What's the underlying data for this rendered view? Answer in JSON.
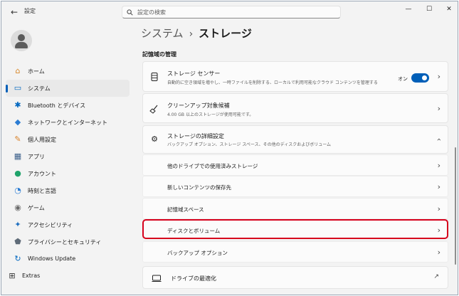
{
  "app": {
    "title": "設定",
    "back_icon": "arrow-left-icon"
  },
  "search": {
    "placeholder": "設定の検索"
  },
  "window_controls": {
    "minimize": "—",
    "maximize": "☐",
    "close": "✕"
  },
  "sidebar": {
    "items": [
      {
        "label": "ホーム",
        "icon": "home-icon",
        "glyph": "⌂",
        "color": "#d9882a",
        "active": false
      },
      {
        "label": "システム",
        "icon": "system-icon",
        "glyph": "▭",
        "color": "#0067c0",
        "active": true
      },
      {
        "label": "Bluetooth とデバイス",
        "icon": "bluetooth-icon",
        "glyph": "✱",
        "color": "#0067c0",
        "active": false
      },
      {
        "label": "ネットワークとインターネット",
        "icon": "network-icon",
        "glyph": "◆",
        "color": "#2b7cd3",
        "active": false
      },
      {
        "label": "個人用設定",
        "icon": "brush-icon",
        "glyph": "✎",
        "color": "#d9822b",
        "active": false
      },
      {
        "label": "アプリ",
        "icon": "apps-icon",
        "glyph": "▦",
        "color": "#3b5f8a",
        "active": false
      },
      {
        "label": "アカウント",
        "icon": "account-icon",
        "glyph": "●",
        "color": "#1fa36a",
        "active": false
      },
      {
        "label": "時刻と言語",
        "icon": "time-language-icon",
        "glyph": "◔",
        "color": "#2b7cd3",
        "active": false
      },
      {
        "label": "ゲーム",
        "icon": "gaming-icon",
        "glyph": "◉",
        "color": "#6b6b6b",
        "active": false
      },
      {
        "label": "アクセシビリティ",
        "icon": "accessibility-icon",
        "glyph": "✦",
        "color": "#1f6fc0",
        "active": false
      },
      {
        "label": "プライバシーとセキュリティ",
        "icon": "shield-icon",
        "glyph": "⬟",
        "color": "#5f6b78",
        "active": false
      },
      {
        "label": "Windows Update",
        "icon": "windows-update-icon",
        "glyph": "↻",
        "color": "#0067c0",
        "active": false
      },
      {
        "label": "Extras",
        "icon": "extras-icon",
        "glyph": "⊞",
        "color": "#333333",
        "active": false
      }
    ]
  },
  "breadcrumb": {
    "parent": "システム",
    "separator": "›",
    "current": "ストレージ"
  },
  "section": {
    "title": "記憶域の管理"
  },
  "storage_sense": {
    "title": "ストレージ センサー",
    "description": "自動的に空き領域を増やし、一時ファイルを削除する、ローカルで利用可能なクラウド コンテンツを管理する",
    "toggle_label": "オン",
    "toggle_on": true,
    "icon": "storage-icon"
  },
  "cleanup": {
    "title": "クリーンアップ対象候補",
    "description": "4.00 GB 以上のストレージが使用可能です。",
    "icon": "broom-icon"
  },
  "advanced": {
    "title": "ストレージの詳細設定",
    "description": "バックアップ オプション、ストレージ スペース、その他のディスクおよびボリューム",
    "icon": "gear-icon",
    "expanded": true,
    "items": [
      "他のドライブでの使用済みストレージ",
      "新しいコンテンツの保存先",
      "記憶域スペース",
      "ディスクとボリューム",
      "バックアップ オプション"
    ],
    "highlighted_item": "ディスクとボリューム"
  },
  "optimize": {
    "title": "ドライブの最適化",
    "icon": "drive-icon",
    "action_icon": "external-link-icon"
  },
  "colors": {
    "accent": "#005fb8",
    "highlight": "#d6001c"
  }
}
